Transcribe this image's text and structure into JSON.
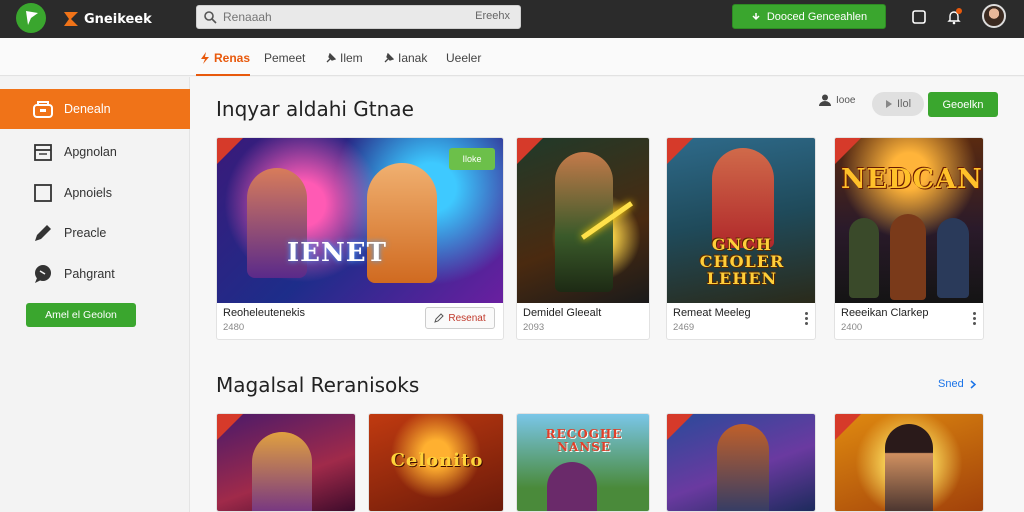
{
  "app": {
    "brand_name": "Gneikeek"
  },
  "topbar": {
    "search_placeholder": "Renaaah",
    "search_filter": "Ereehx",
    "cta_label": "Dooced Genceahlen"
  },
  "subnav": {
    "tabs": [
      {
        "label": "Renas",
        "active": true
      },
      {
        "label": "Pemeet",
        "active": false
      },
      {
        "label": "Ilem",
        "active": false
      },
      {
        "label": "Ianak",
        "active": false
      },
      {
        "label": "Ueeler",
        "active": false
      }
    ]
  },
  "sidebar": {
    "items": [
      {
        "label": "Denealn",
        "icon": "store-icon",
        "active": true
      },
      {
        "label": "Apgnolan",
        "icon": "calendar-icon",
        "active": false
      },
      {
        "label": "Apnoiels",
        "icon": "square-icon",
        "active": false
      },
      {
        "label": "Preacle",
        "icon": "pencil-icon",
        "active": false
      },
      {
        "label": "Pahgrant",
        "icon": "chat-icon",
        "active": false
      }
    ],
    "cta_label": "Amel el Geolon"
  },
  "section1": {
    "title": "Inqyar aldahi Gtnae",
    "sort_label": "Iooe",
    "toggle_label": "Ilol",
    "button_label": "Geoelkn",
    "cards": [
      {
        "name": "Reoheleutenekis",
        "meta": "2480",
        "art_title": "IENET",
        "badge": "Iloke",
        "action": "Resenat"
      },
      {
        "name": "Demidel Gleealt",
        "meta": "2093",
        "art_title": ""
      },
      {
        "name": "Remeat Meeleg",
        "meta": "2469",
        "art_title": "GNCH CHOLER LEHEN"
      },
      {
        "name": "Reeeikan Clarkep",
        "meta": "2400",
        "art_title": "NEDCAN"
      }
    ]
  },
  "section2": {
    "title": "Magalsal Reranisoks",
    "see_all": "Sned",
    "cards": [
      {
        "art_title": ""
      },
      {
        "art_title": "Celonito"
      },
      {
        "art_title": "RECOGHE NANSE"
      },
      {
        "art_title": ""
      },
      {
        "art_title": ""
      }
    ]
  },
  "colors": {
    "accent": "#f07318",
    "green": "#3aa62e",
    "topbar": "#2b2b2b"
  }
}
